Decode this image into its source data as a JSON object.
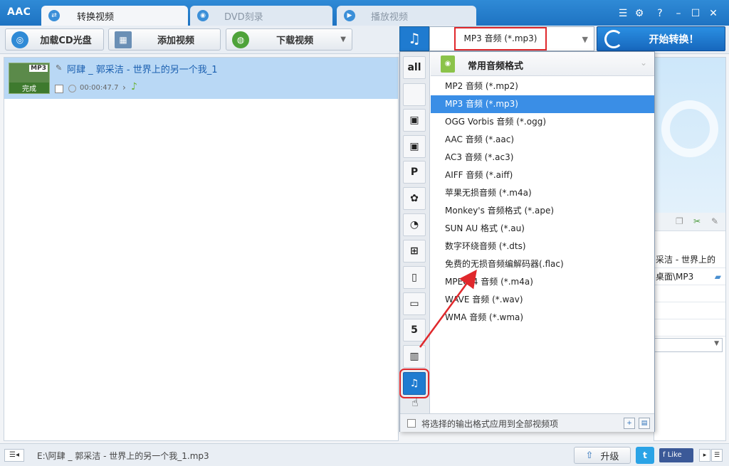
{
  "app": {
    "logo": "AAC"
  },
  "tabs": [
    {
      "label": "转换视频",
      "active": true
    },
    {
      "label": "DVD刻录",
      "active": false
    },
    {
      "label": "播放视频",
      "active": false
    }
  ],
  "toolbar": {
    "load_cd": "加载CD光盘",
    "add_video": "添加视频",
    "download_video": "下载视频"
  },
  "file": {
    "title": "阿肆 _ 郭采洁 - 世界上的另一个我_1",
    "thumb_tag": "MP3",
    "status": "完成",
    "duration": "00:00:47.7"
  },
  "format": {
    "selected": "MP3 音频 (*.mp3)",
    "convert_label": "开始转换！"
  },
  "popup": {
    "group_title": "常用音频格式",
    "formats": [
      "MP2 音频 (*.mp2)",
      "MP3 音频 (*.mp3)",
      "OGG Vorbis 音频 (*.ogg)",
      "AAC 音频 (*.aac)",
      "AC3 音频 (*.ac3)",
      "AIFF 音频 (*.aiff)",
      "苹果无损音频 (*.m4a)",
      "Monkey's 音频格式 (*.ape)",
      "SUN AU 格式 (*.au)",
      "数字环绕音频 (*.dts)",
      "免费的无损音频编解码器(.flac)",
      "MPEG-4 音频 (*.m4a)",
      "WAVE 音频 (*.wav)",
      "WMA 音频 (*.wma)"
    ],
    "selected_index": 1,
    "footer_label": "将选择的输出格式应用到全部视频项",
    "categories": [
      "all",
      "apple",
      "android-s",
      "android",
      "playstation",
      "huawei",
      "lg",
      "windows",
      "phone",
      "tv",
      "html5",
      "film",
      "music"
    ]
  },
  "right_panel": {
    "row1": "采洁 - 世界上的",
    "row2": "桌面\\MP3"
  },
  "status": {
    "path": "E:\\阿肆 _ 郭采洁 - 世界上的另一个我_1.mp3",
    "upgrade": "升级",
    "like": "Like"
  },
  "colors": {
    "accent": "#1f7bd0",
    "highlight": "#e0282c",
    "selected_row": "#3a8ee6"
  }
}
